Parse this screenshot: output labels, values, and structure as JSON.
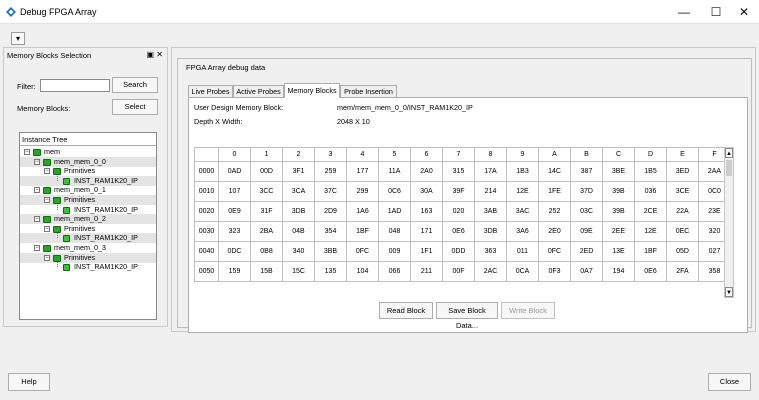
{
  "window": {
    "title": "Debug FPGA Array",
    "minimize": "—",
    "maximize": "☐",
    "close": "✕"
  },
  "toolbar": {
    "menu_glyph": "▾"
  },
  "left_panel": {
    "title": "Memory Blocks Selection",
    "controls": "▣ ✕",
    "filter_label": "Filter:",
    "filter_value": "",
    "search_label": "Search",
    "memory_blocks_label": "Memory Blocks:",
    "select_label": "Select",
    "tree_header": "Instance Tree",
    "tree": [
      {
        "label": "mem",
        "level": 0,
        "exp": "⊟"
      },
      {
        "label": "mem_mem_0_0",
        "level": 1,
        "exp": "⊟"
      },
      {
        "label": "Primitives",
        "level": 2,
        "exp": "⊟"
      },
      {
        "label": "INST_RAM1K20_IP",
        "level": 3,
        "exp": ""
      },
      {
        "label": "mem_mem_0_1",
        "level": 1,
        "exp": "⊟"
      },
      {
        "label": "Primitives",
        "level": 2,
        "exp": "⊟"
      },
      {
        "label": "INST_RAM1K20_IP",
        "level": 3,
        "exp": ""
      },
      {
        "label": "mem_mem_0_2",
        "level": 1,
        "exp": "⊟"
      },
      {
        "label": "Primitives",
        "level": 2,
        "exp": "⊟"
      },
      {
        "label": "INST_RAM1K20_IP",
        "level": 3,
        "exp": ""
      },
      {
        "label": "mem_mem_0_3",
        "level": 1,
        "exp": "⊟"
      },
      {
        "label": "Primitives",
        "level": 2,
        "exp": "⊟"
      },
      {
        "label": "INST_RAM1K20_IP",
        "level": 3,
        "exp": ""
      }
    ]
  },
  "main": {
    "group_title": "FPGA Array debug data",
    "tabs": [
      {
        "label": "Live Probes",
        "active": false
      },
      {
        "label": "Active Probes",
        "active": false
      },
      {
        "label": "Memory Blocks",
        "active": true
      },
      {
        "label": "Probe Insertion",
        "active": false
      }
    ],
    "block_label": "User Design Memory Block:",
    "block_value": "mem/mem_mem_0_0/INST_RAM1K20_IP",
    "depth_label": "Depth X Width:",
    "depth_value": "2048 X 10",
    "columns": [
      "0",
      "1",
      "2",
      "3",
      "4",
      "5",
      "6",
      "7",
      "8",
      "9",
      "A",
      "B",
      "C",
      "D",
      "E",
      "F"
    ],
    "rows": [
      {
        "addr": "0000",
        "cells": [
          "0AD",
          "00D",
          "3F1",
          "259",
          "177",
          "11A",
          "2A0",
          "315",
          "17A",
          "1B3",
          "14C",
          "387",
          "3BE",
          "1B5",
          "3ED",
          "2AA"
        ]
      },
      {
        "addr": "0010",
        "cells": [
          "107",
          "3CC",
          "3CA",
          "37C",
          "299",
          "0C6",
          "30A",
          "39F",
          "214",
          "12E",
          "1FE",
          "37D",
          "39B",
          "036",
          "3CE",
          "0C0"
        ]
      },
      {
        "addr": "0020",
        "cells": [
          "0E9",
          "31F",
          "3DB",
          "2D9",
          "1A6",
          "1AD",
          "163",
          "020",
          "3AB",
          "3AC",
          "252",
          "03C",
          "39B",
          "2CE",
          "22A",
          "23E"
        ]
      },
      {
        "addr": "0030",
        "cells": [
          "323",
          "2BA",
          "04B",
          "354",
          "1BF",
          "048",
          "171",
          "0E6",
          "3DB",
          "3A6",
          "2E0",
          "09E",
          "2EE",
          "12E",
          "0EC",
          "320"
        ]
      },
      {
        "addr": "0040",
        "cells": [
          "0DC",
          "0B8",
          "340",
          "3BB",
          "0FC",
          "009",
          "1F1",
          "0DD",
          "363",
          "011",
          "0FC",
          "2ED",
          "13E",
          "1BF",
          "05D",
          "027"
        ]
      },
      {
        "addr": "0050",
        "cells": [
          "159",
          "15B",
          "15C",
          "135",
          "104",
          "066",
          "211",
          "00F",
          "2AC",
          "0CA",
          "0F3",
          "0A7",
          "194",
          "0E6",
          "2FA",
          "358"
        ]
      }
    ],
    "read_label": "Read Block",
    "save_label": "Save Block Data...",
    "write_label": "Write Block"
  },
  "footer": {
    "help_label": "Help",
    "close_label": "Close"
  }
}
